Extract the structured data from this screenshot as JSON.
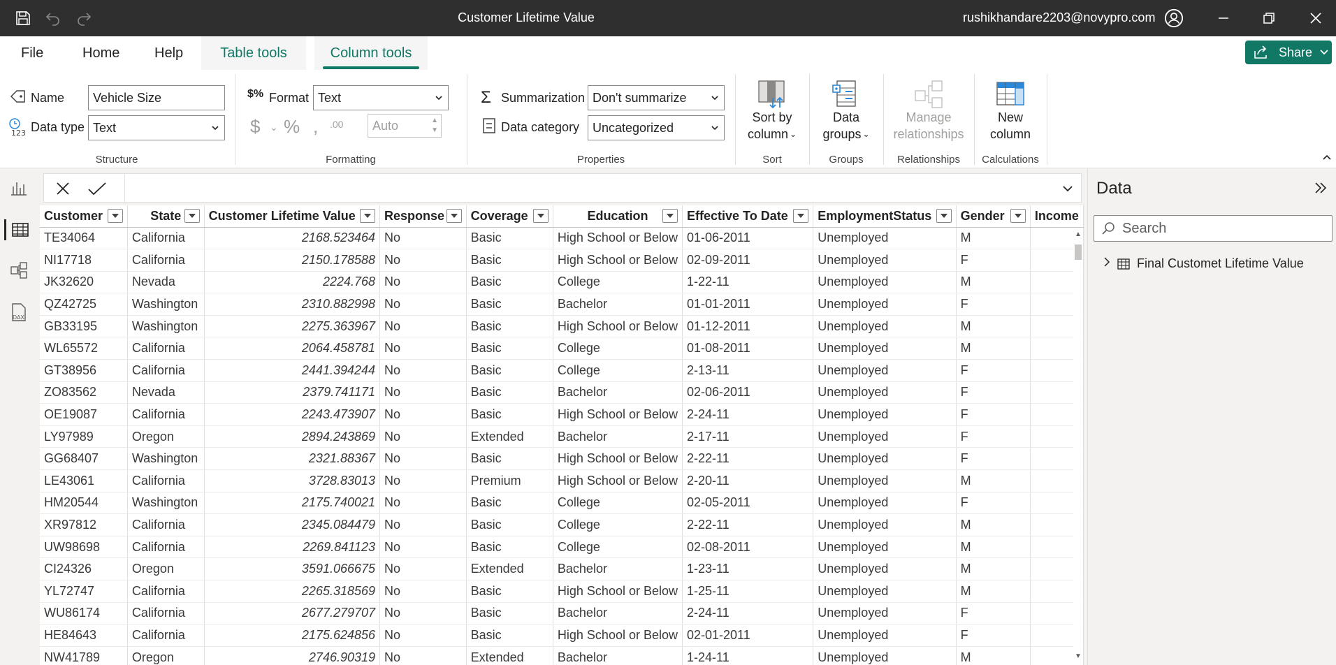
{
  "window": {
    "title": "Customer Lifetime Value",
    "user": "rushikhandare2203@novypro.com"
  },
  "menu": {
    "tabs": [
      "File",
      "Home",
      "Help",
      "Table tools",
      "Column tools"
    ],
    "active": "Column tools",
    "share_label": "Share"
  },
  "ribbon": {
    "structure": {
      "group_label": "Structure",
      "name_label": "Name",
      "name_value": "Vehicle Size",
      "datatype_label": "Data type",
      "datatype_value": "Text"
    },
    "formatting": {
      "group_label": "Formatting",
      "format_label": "Format",
      "format_value": "Text",
      "decimal_placeholder": "Auto"
    },
    "properties": {
      "group_label": "Properties",
      "summarization_label": "Summarization",
      "summarization_value": "Don't summarize",
      "category_label": "Data category",
      "category_value": "Uncategorized"
    },
    "sort": {
      "group_label": "Sort",
      "line1": "Sort by",
      "line2": "column"
    },
    "groups": {
      "group_label": "Groups",
      "line1": "Data",
      "line2": "groups"
    },
    "relationships": {
      "group_label": "Relationships",
      "line1": "Manage",
      "line2": "relationships"
    },
    "calculations": {
      "group_label": "Calculations",
      "line1": "New",
      "line2": "column"
    }
  },
  "table": {
    "columns": [
      "Customer",
      "State",
      "Customer Lifetime Value",
      "Response",
      "Coverage",
      "Education",
      "Effective To Date",
      "EmploymentStatus",
      "Gender",
      "Income"
    ],
    "rows": [
      [
        "TE34064",
        "California",
        "2168.523464",
        "No",
        "Basic",
        "High School or Below",
        "01-06-2011",
        "Unemployed",
        "M",
        ""
      ],
      [
        "NI17718",
        "California",
        "2150.178588",
        "No",
        "Basic",
        "High School or Below",
        "02-09-2011",
        "Unemployed",
        "F",
        ""
      ],
      [
        "JK32620",
        "Nevada",
        "2224.768",
        "No",
        "Basic",
        "College",
        "1-22-11",
        "Unemployed",
        "M",
        ""
      ],
      [
        "QZ42725",
        "Washington",
        "2310.882998",
        "No",
        "Basic",
        "Bachelor",
        "01-01-2011",
        "Unemployed",
        "F",
        ""
      ],
      [
        "GB33195",
        "Washington",
        "2275.363967",
        "No",
        "Basic",
        "High School or Below",
        "01-12-2011",
        "Unemployed",
        "M",
        ""
      ],
      [
        "WL65572",
        "California",
        "2064.458781",
        "No",
        "Basic",
        "College",
        "01-08-2011",
        "Unemployed",
        "M",
        ""
      ],
      [
        "GT38956",
        "California",
        "2441.394244",
        "No",
        "Basic",
        "College",
        "2-13-11",
        "Unemployed",
        "F",
        ""
      ],
      [
        "ZO83562",
        "Nevada",
        "2379.741171",
        "No",
        "Basic",
        "Bachelor",
        "02-06-2011",
        "Unemployed",
        "F",
        ""
      ],
      [
        "OE19087",
        "California",
        "2243.473907",
        "No",
        "Basic",
        "High School or Below",
        "2-24-11",
        "Unemployed",
        "F",
        ""
      ],
      [
        "LY97989",
        "Oregon",
        "2894.243869",
        "No",
        "Extended",
        "Bachelor",
        "2-17-11",
        "Unemployed",
        "F",
        ""
      ],
      [
        "GG68407",
        "Washington",
        "2321.88367",
        "No",
        "Basic",
        "High School or Below",
        "2-22-11",
        "Unemployed",
        "F",
        ""
      ],
      [
        "LE43061",
        "California",
        "3728.83013",
        "No",
        "Premium",
        "High School or Below",
        "2-20-11",
        "Unemployed",
        "M",
        ""
      ],
      [
        "HM20544",
        "Washington",
        "2175.740021",
        "No",
        "Basic",
        "College",
        "02-05-2011",
        "Unemployed",
        "F",
        ""
      ],
      [
        "XR97812",
        "California",
        "2345.084479",
        "No",
        "Basic",
        "College",
        "2-22-11",
        "Unemployed",
        "M",
        ""
      ],
      [
        "UW98698",
        "California",
        "2269.841123",
        "No",
        "Basic",
        "College",
        "02-08-2011",
        "Unemployed",
        "M",
        ""
      ],
      [
        "CI24326",
        "Oregon",
        "3591.066675",
        "No",
        "Extended",
        "Bachelor",
        "1-23-11",
        "Unemployed",
        "M",
        ""
      ],
      [
        "YL72747",
        "California",
        "2265.318569",
        "No",
        "Basic",
        "High School or Below",
        "1-25-11",
        "Unemployed",
        "M",
        ""
      ],
      [
        "WU86174",
        "California",
        "2677.279707",
        "No",
        "Basic",
        "Bachelor",
        "2-24-11",
        "Unemployed",
        "F",
        ""
      ],
      [
        "HE84643",
        "California",
        "2175.624856",
        "No",
        "Basic",
        "High School or Below",
        "02-01-2011",
        "Unemployed",
        "F",
        ""
      ],
      [
        "NW41789",
        "Oregon",
        "2746.90319",
        "No",
        "Extended",
        "Bachelor",
        "1-24-11",
        "Unemployed",
        "M",
        ""
      ]
    ]
  },
  "data_pane": {
    "title": "Data",
    "search_placeholder": "Search",
    "tables": [
      "Final Customet Lifetime Value"
    ]
  },
  "colors": {
    "accent": "#117865",
    "titlebar": "#2f2f2f"
  }
}
